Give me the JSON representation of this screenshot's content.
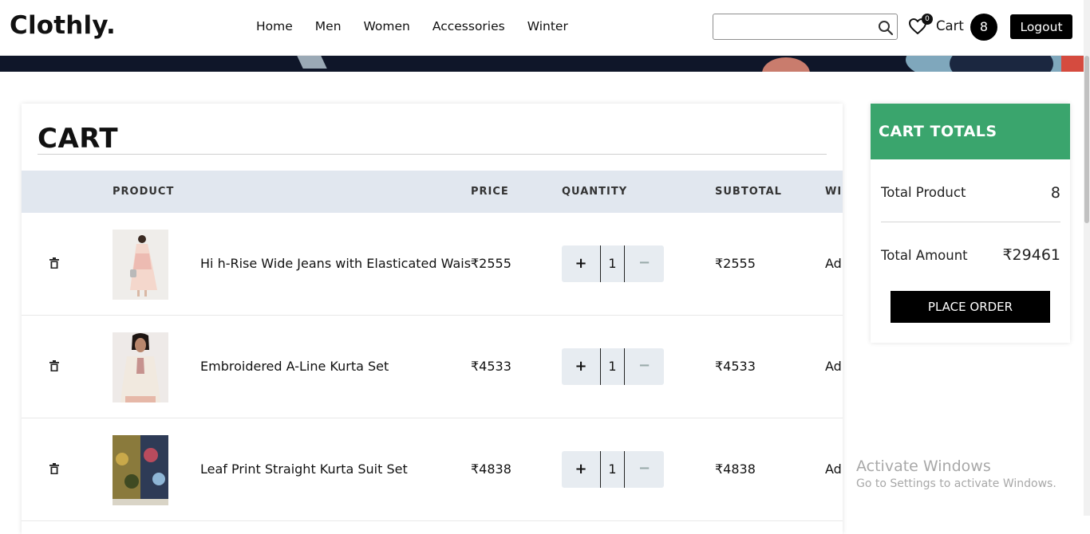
{
  "brand": {
    "logo": "Clothly."
  },
  "nav": {
    "items": [
      "Home",
      "Men",
      "Women",
      "Accessories",
      "Winter"
    ]
  },
  "search": {
    "value": "",
    "placeholder": ""
  },
  "header": {
    "wishlist_count": "0",
    "cart_label": "Cart",
    "cart_count": "8",
    "logout_label": "Logout"
  },
  "cart": {
    "title": "CART",
    "columns": {
      "product": "PRODUCT",
      "price": "PRICE",
      "quantity": "QUANTITY",
      "subtotal": "SUBTOTAL",
      "wishlist": "WIS"
    },
    "rows": [
      {
        "name": "Hi h-Rise Wide Jeans with Elasticated Waist",
        "price": "₹2555",
        "qty": "1",
        "subtotal": "₹2555",
        "wishlist": "Ad",
        "plus": "+",
        "minus": "−"
      },
      {
        "name": "Embroidered A-Line Kurta Set",
        "price": "₹4533",
        "qty": "1",
        "subtotal": "₹4533",
        "wishlist": "Ad",
        "plus": "+",
        "minus": "−"
      },
      {
        "name": "Leaf Print Straight Kurta Suit Set",
        "price": "₹4838",
        "qty": "1",
        "subtotal": "₹4838",
        "wishlist": "Ad",
        "plus": "+",
        "minus": "−"
      }
    ]
  },
  "totals": {
    "title": "CART TOTALS",
    "product_label": "Total Product",
    "product_value": "8",
    "amount_label": "Total Amount",
    "amount_value": "₹29461",
    "place_order_label": "PLACE ORDER"
  },
  "watermark": {
    "title": "Activate Windows",
    "subtitle": "Go to Settings to activate Windows."
  },
  "colors": {
    "accent_green": "#3aa56d",
    "header_bg": "#e1e7ef",
    "banner_dark": "#0f1629"
  }
}
